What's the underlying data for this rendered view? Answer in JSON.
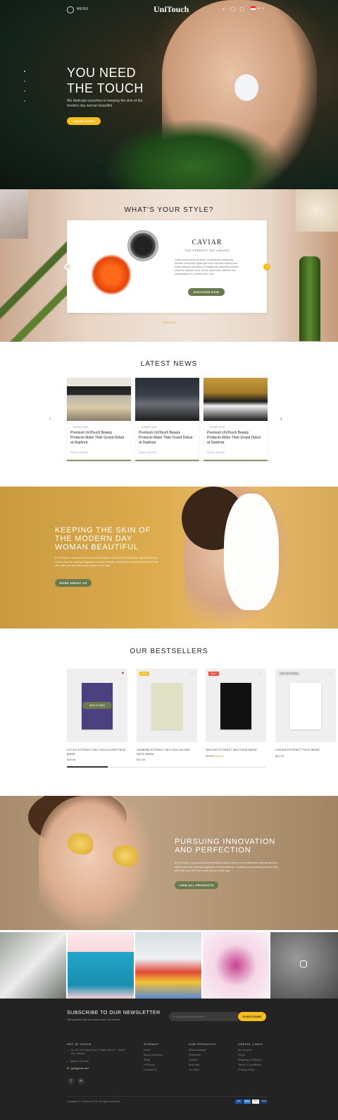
{
  "header": {
    "menu_label": "MENU",
    "logo": "UniTouch",
    "lang": "SG"
  },
  "hero": {
    "title_line1": "YOU NEED",
    "title_line2": "THE TOUCH",
    "subtitle": "We dedicate ourselves to keeping the skin of the modern day woman beautiful",
    "cta": "LEARN MORE"
  },
  "style_section": {
    "title": "WHAT'S YOUR STYLE?",
    "product_title": "CAVIAR",
    "product_subtitle": "THE PERFECT ANTI-AGING",
    "description": "Lorem ipsum dolor sit amet, consectetuer adipiscing. Aenean commodo ligula eget dolor. Aenean massa cum sociis natoque penatibus et magnis dis parturient montes, nascetur ridiculus mus. Donec quam felis, ultricies nec, pellentesque eu, pretium quis, sem.",
    "cta": "DISCOVER NOW",
    "view_all": "VIEW ALL"
  },
  "news": {
    "title": "LATEST NEWS",
    "items": [
      {
        "date": "20 MAR 2018",
        "title": "Premium UniTouch Beauty Products Make Their Grand Debut at Sephora",
        "more": "READ MORE"
      },
      {
        "date": "20 MAR 2018",
        "title": "Premium UniTouch Beauty Products Make Their Grand Debut at Sephora",
        "more": "READ MORE"
      },
      {
        "date": "20 MAR 2018",
        "title": "Premium UniTouch Beauty Products Make Their Grand Debut at Sephora",
        "more": "READ MORE"
      }
    ]
  },
  "mask_section": {
    "title": "KEEPING THE SKIN OF THE MODERN DAY WOMAN BEAUTIFUL",
    "description": "At UniTouch, our products are developed with a blend of chemical-free ingredients from nature plus the calming fragrance of floral extracts, resulting in a wonderful product that will make you feel like a new person every day.",
    "cta": "MORE ABOUT US"
  },
  "bestsellers": {
    "title": "OUR BESTSELLERS",
    "add_to_bag": "ADD TO BAG",
    "products": [
      {
        "name": "LOTUS EXTRACT BIO CELLULOSE FACE MASK",
        "price": "$18.00",
        "old_price": "",
        "badge": "",
        "color": "#4b4180"
      },
      {
        "name": "JASMINE EXTRACT BIO CELLULOSE FACE MASK",
        "price": "$12.00",
        "old_price": "",
        "badge": "NEW",
        "color": "#dfe0c6"
      },
      {
        "name": "ORCHID EXTRACT BIO FACE MASK",
        "price": "$28.00",
        "old_price": "$35.00",
        "badge": "SALE",
        "color": "#111111"
      },
      {
        "name": "CAVIAR EXTRACT FACE MASK",
        "price": "$12.00",
        "old_price": "",
        "badge": "OUT OF STOCK",
        "color": "#eeeeee"
      }
    ]
  },
  "innovation": {
    "title": "PURSUING INNOVATION AND PERFECTION",
    "description": "At UniTouch, our products are developed with a blend of chemical-free ingredients from nature plus the calming fragrance of floral extracts, resulting in a wonderful product that will make you feel like a new person every day.",
    "cta": "VIEW ALL PRODUCTS"
  },
  "newsletter": {
    "title": "SUBSCRIBE TO OUR NEWSLETTER",
    "subtitle": "Get updated with our latest news and events",
    "placeholder": "Enter your email address",
    "cta": "SUBSCRIBE"
  },
  "footer": {
    "contact_head": "GET IN TOUCH",
    "address": "No. 20, Kim Yam Road, Tower Unit #1-, Tower 105, Taiwan",
    "phone": "(886) 0123 456",
    "email": "go@gmail.com",
    "sitemap_head": "SITEMAP",
    "sitemap": [
      "Home",
      "About UniTouch",
      "Shop",
      "UniTouch",
      "Contact Us"
    ],
    "products_head": "OUR PRODUCTS",
    "products": [
      "What's Beauty",
      "Perfection",
      "Garden",
      "Best Buy",
      "On Sale!"
    ],
    "useful_head": "USEFUL LINKS",
    "useful": [
      "My Account",
      "FAQs",
      "Shipping & Delivery",
      "Terms & Conditions",
      "Privacy Policy"
    ],
    "copyright": "Copyright © UniTouch 2018. All rights reserved.",
    "payments": [
      "VISA",
      "AMEX",
      "MC",
      "PAYPAL"
    ]
  },
  "colors": {
    "accent_yellow": "#f4bd20",
    "accent_green": "#6a7a4e",
    "footer_bg": "#232323"
  }
}
